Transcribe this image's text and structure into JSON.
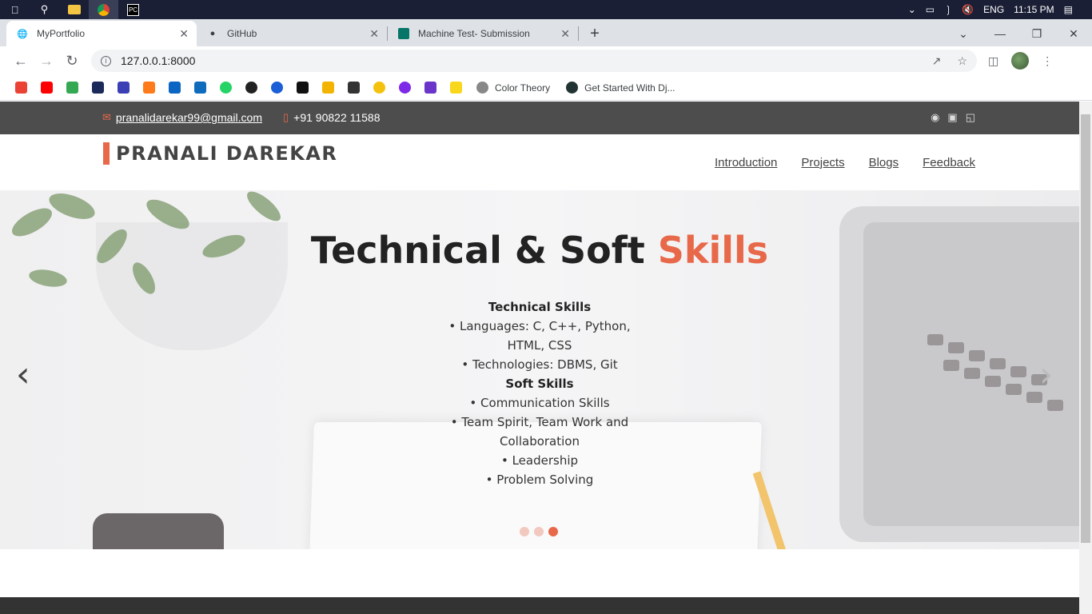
{
  "taskbar": {
    "language": "ENG",
    "time": "11:15 PM"
  },
  "browser": {
    "tabs": [
      {
        "label": "MyPortfolio"
      },
      {
        "label": "GitHub"
      },
      {
        "label": "Machine Test- Submission"
      }
    ],
    "url": "127.0.0.1:8000",
    "bookmarks": [
      {
        "label": "Color Theory"
      },
      {
        "label": "Get Started With Dj..."
      }
    ]
  },
  "site": {
    "email": "pranalidarekar99@gmail.com",
    "phone": "+91 90822 11588",
    "logo": "PRANALI DAREKAR",
    "nav": [
      "Introduction",
      "Projects",
      "Blogs",
      "Feedback"
    ],
    "hero": {
      "title_main": "Technical & Soft ",
      "title_accent": "Skills",
      "tech_heading": "Technical Skills",
      "tech_items": [
        "• Languages: C, C++, Python, HTML, CSS",
        "• Technologies: DBMS, Git"
      ],
      "soft_heading": "Soft Skills",
      "soft_items": [
        "• Communication Skills",
        "• Team Spirit, Team Work and Collaboration",
        "• Leadership",
        "• Problem Solving"
      ],
      "active_slide": 3,
      "slide_count": 3
    }
  },
  "colors": {
    "accent": "#e8684a",
    "topbar": "#4d4d4d"
  }
}
